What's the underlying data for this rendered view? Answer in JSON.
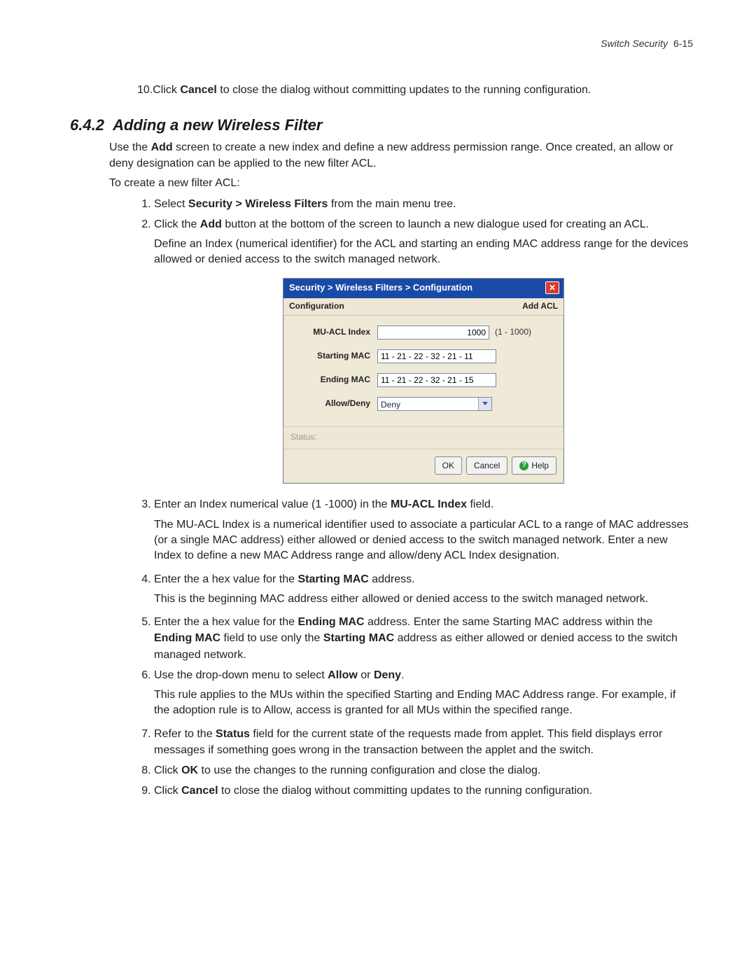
{
  "header": {
    "chapter_title": "Switch Security",
    "page_num": "6-15"
  },
  "pre_step": {
    "num": "10.",
    "text_a": "Click ",
    "bold": "Cancel",
    "text_b": " to close the dialog without committing updates to the running configuration."
  },
  "section": {
    "number": "6.4.2",
    "title": "Adding a new Wireless Filter"
  },
  "intro": {
    "p1_a": "Use the ",
    "p1_bold": "Add",
    "p1_b": " screen to create a new index and define a new address permission range. Once created, an allow or deny designation can be applied to the new filter ACL.",
    "p2": "To create a new filter ACL:"
  },
  "dialog": {
    "title": "Security > Wireless Filters > Configuration",
    "sub_left": "Configuration",
    "sub_right": "Add ACL",
    "labels": {
      "index": "MU-ACL Index",
      "start": "Starting MAC",
      "end": "Ending MAC",
      "allowdeny": "Allow/Deny"
    },
    "values": {
      "index": "1000",
      "index_range": "(1 - 1000)",
      "start": "11 - 21 - 22 - 32 - 21 - 11",
      "end": "11 - 21 - 22 - 32 - 21 - 15",
      "allowdeny": "Deny"
    },
    "status_label": "Status:",
    "buttons": {
      "ok": "OK",
      "cancel": "Cancel",
      "help": "Help"
    }
  },
  "steps": {
    "s1_a": "Select ",
    "s1_bold": "Security > Wireless Filters",
    "s1_b": " from the main menu tree.",
    "s2_a": "Click the ",
    "s2_bold": "Add",
    "s2_b": " button at the bottom of the screen to launch a new dialogue used for creating an ACL.",
    "s2_p": "Define an Index (numerical identifier) for the ACL and starting an ending MAC address range for the devices allowed or denied access to the switch managed network.",
    "s3_a": "Enter an Index numerical value (1 -1000) in the ",
    "s3_bold": "MU-ACL Index",
    "s3_b": " field.",
    "s3_p": "The MU-ACL Index is a numerical identifier used to associate a particular ACL to a range of MAC addresses (or a single MAC address) either allowed or denied access to the switch managed network. Enter a new Index to define a new MAC Address range and allow/deny ACL Index designation.",
    "s4_a": "Enter the a hex value for the ",
    "s4_bold": "Starting MAC",
    "s4_b": " address.",
    "s4_p": "This is the beginning MAC address either allowed or denied access to the switch managed network.",
    "s5_a": "Enter the a hex value for the ",
    "s5_bold1": "Ending MAC",
    "s5_b": " address. Enter the same Starting MAC address within the ",
    "s5_bold2": "Ending MAC",
    "s5_c": " field to use only the ",
    "s5_bold3": "Starting MAC",
    "s5_d": " address as either allowed or denied access to the switch managed network.",
    "s6_a": "Use the drop-down menu to select ",
    "s6_bold1": "Allow",
    "s6_b": " or ",
    "s6_bold2": "Deny",
    "s6_c": ".",
    "s6_p": "This rule applies to the MUs within the specified Starting and Ending MAC Address range. For example, if the adoption rule is to Allow, access is granted for all MUs within the specified range.",
    "s7_a": "Refer to the ",
    "s7_bold": "Status",
    "s7_b": " field for the current state of the requests made from applet. This field displays error messages if something goes wrong in the transaction between the applet and the switch.",
    "s8_a": "Click ",
    "s8_bold": "OK",
    "s8_b": " to use the changes to the running configuration and close the dialog.",
    "s9_a": "Click ",
    "s9_bold": "Cancel",
    "s9_b": " to close the dialog without committing updates to the running configuration."
  }
}
